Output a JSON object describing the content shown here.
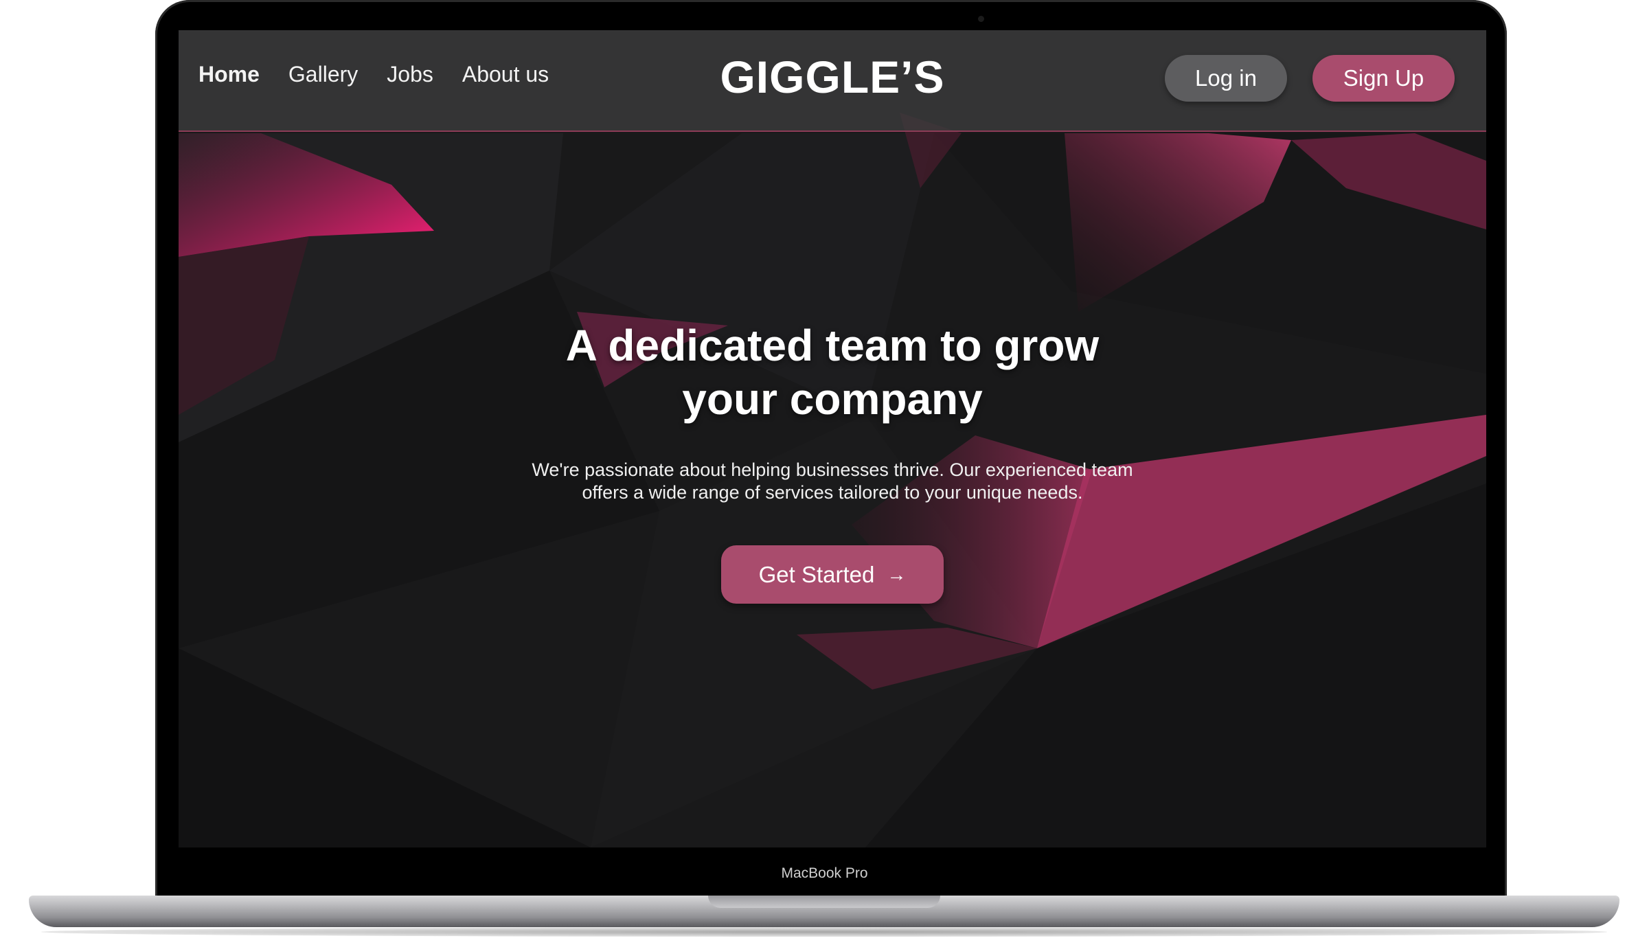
{
  "nav": {
    "links": [
      "Home",
      "Gallery",
      "Jobs",
      "About us"
    ],
    "active": "Home",
    "brand": "GIGGLE’S",
    "login_label": "Log in",
    "signup_label": "Sign Up"
  },
  "hero": {
    "title": "A dedicated team to grow your company",
    "subtitle": "We're passionate about helping businesses thrive. Our experienced team offers a wide range of services tailored to your unique needs.",
    "cta_label": "Get Started",
    "cta_icon": "arrow-right-icon"
  },
  "device": {
    "model_label": "MacBook Pro"
  },
  "colors": {
    "accent": "#a94c6d",
    "background": "#1a1a1b",
    "nav_bg": "#3c3c3e",
    "login_bg": "#5d5d5f",
    "highlight_pink": "#ff1f7a"
  }
}
